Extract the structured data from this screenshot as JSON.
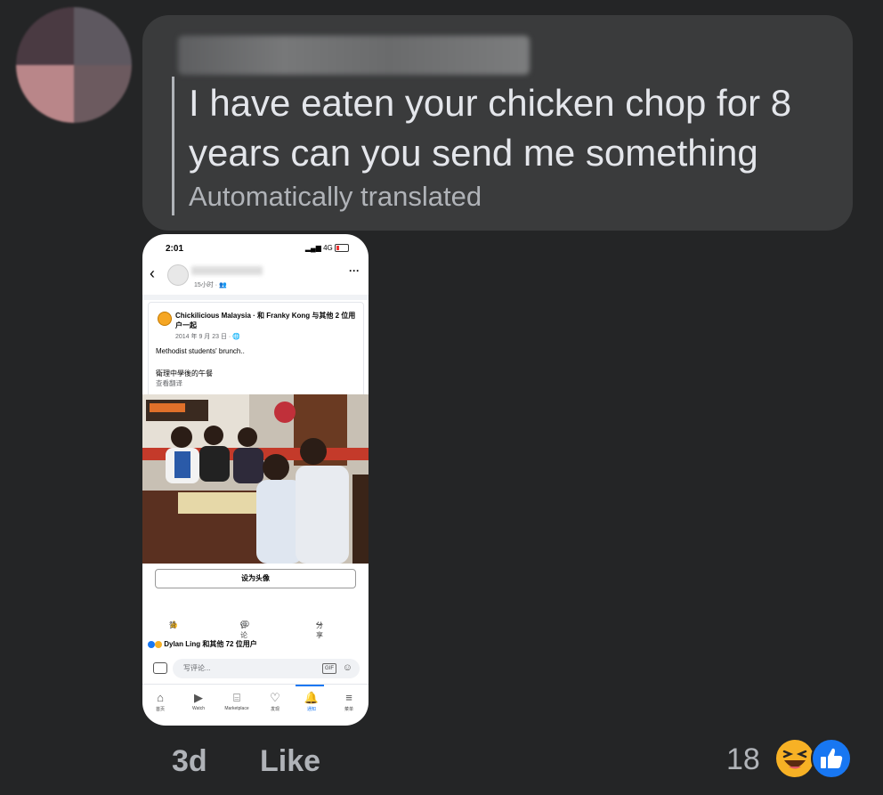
{
  "comment": {
    "text": "I have eaten your chicken chop for 8 years can you send me something",
    "translation_note": "Automatically translated"
  },
  "screenshot": {
    "status_time": "2:01",
    "network": "4G",
    "post_time": "15小时 · ",
    "more": "···",
    "shared_post": {
      "title": "Chickilicious Malaysia · 和 Franky Kong 与其他 2 位用户一起",
      "date": "2014 年 9 月 23 日 · ",
      "caption_en": "Methodist students' brunch..",
      "caption_zh": "衛理中學後的午餐",
      "see_translation": "查看翻译"
    },
    "set_profile_button": "设为头像",
    "actions": {
      "like": "赞",
      "comment": "评论",
      "share": "分享"
    },
    "reactions_summary": "Dylan Ling 和其他 72 位用户",
    "comment_placeholder": "写评论...",
    "gif": "GIF",
    "tabs": [
      {
        "label": "首页",
        "icon": "home-icon"
      },
      {
        "label": "Watch",
        "icon": "watch-icon"
      },
      {
        "label": "Marketplace",
        "icon": "marketplace-icon"
      },
      {
        "label": "发现",
        "icon": "dating-icon"
      },
      {
        "label": "通知",
        "icon": "bell-icon"
      },
      {
        "label": "菜单",
        "icon": "menu-icon"
      }
    ]
  },
  "footer": {
    "time_ago": "3d",
    "like": "Like",
    "reaction_count": "18"
  },
  "colors": {
    "background": "#242526",
    "bubble": "#3a3b3c",
    "text": "#e4e6eb",
    "secondary": "#b0b3b8",
    "fb_blue": "#1877f2",
    "haha_yellow": "#f7b125"
  }
}
